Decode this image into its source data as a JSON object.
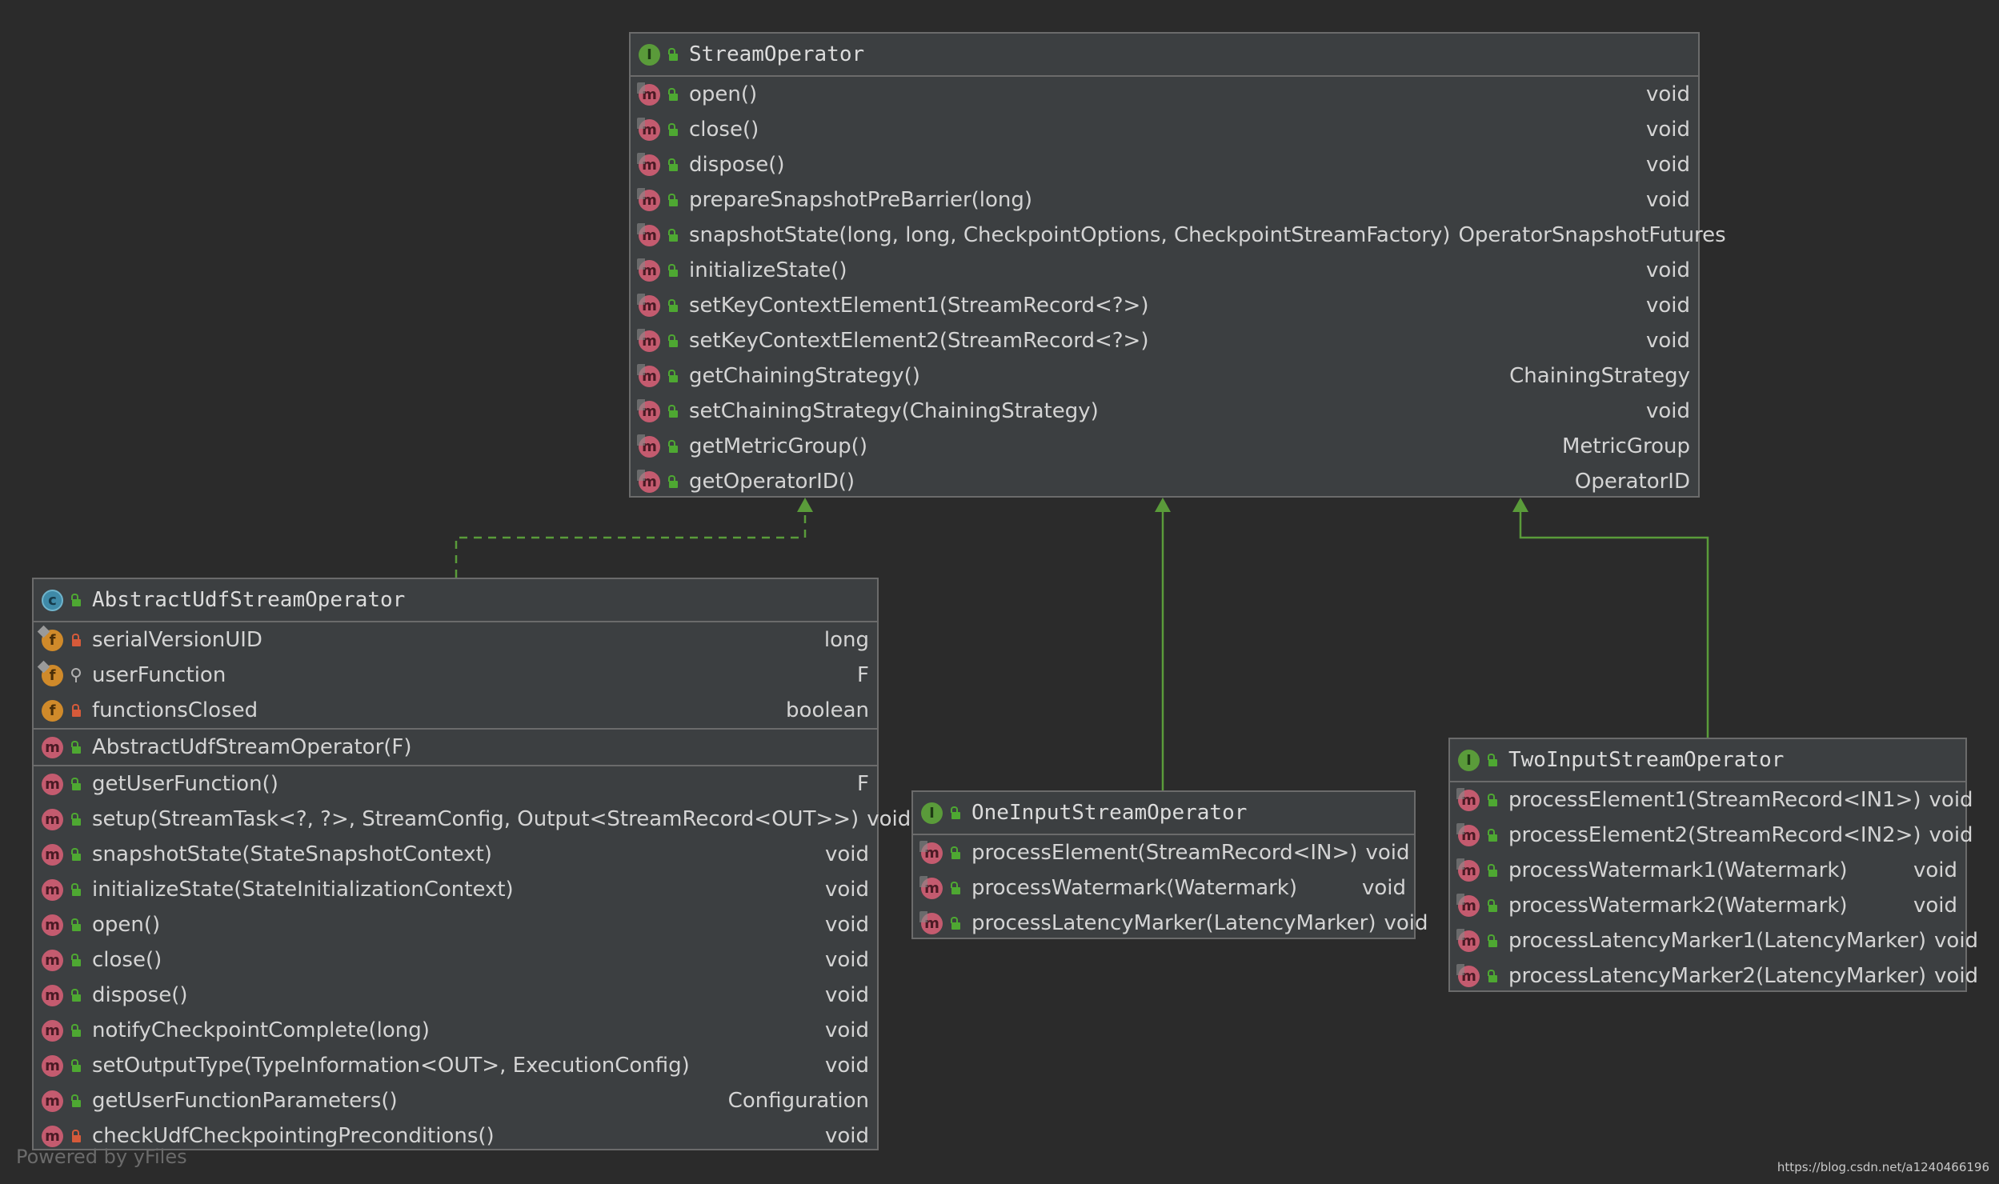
{
  "diagram": {
    "stream_operator": {
      "title": "StreamOperator",
      "kind_icon": "interface-icon",
      "methods": [
        {
          "name": "open()",
          "type": "void"
        },
        {
          "name": "close()",
          "type": "void"
        },
        {
          "name": "dispose()",
          "type": "void"
        },
        {
          "name": "prepareSnapshotPreBarrier(long)",
          "type": "void"
        },
        {
          "name": "snapshotState(long, long, CheckpointOptions, CheckpointStreamFactory)",
          "type": "OperatorSnapshotFutures"
        },
        {
          "name": "initializeState()",
          "type": "void"
        },
        {
          "name": "setKeyContextElement1(StreamRecord<?>)",
          "type": "void"
        },
        {
          "name": "setKeyContextElement2(StreamRecord<?>)",
          "type": "void"
        },
        {
          "name": "getChainingStrategy()",
          "type": "ChainingStrategy"
        },
        {
          "name": "setChainingStrategy(ChainingStrategy)",
          "type": "void"
        },
        {
          "name": "getMetricGroup()",
          "type": "MetricGroup"
        },
        {
          "name": "getOperatorID()",
          "type": "OperatorID"
        }
      ]
    },
    "abstract_udf_stream_operator": {
      "title": "AbstractUdfStreamOperator",
      "kind_icon": "class-icon",
      "fields": [
        {
          "name": "serialVersionUID",
          "type": "long",
          "visibility": "private",
          "static": true
        },
        {
          "name": "userFunction",
          "type": "F",
          "visibility": "protected",
          "static": true
        },
        {
          "name": "functionsClosed",
          "type": "boolean",
          "visibility": "private",
          "static": false
        }
      ],
      "constructors": [
        {
          "name": "AbstractUdfStreamOperator(F)",
          "type": "",
          "visibility": "public"
        }
      ],
      "methods": [
        {
          "name": "getUserFunction()",
          "type": "F",
          "visibility": "public"
        },
        {
          "name": "setup(StreamTask<?, ?>, StreamConfig, Output<StreamRecord<OUT>>)",
          "type": "void",
          "visibility": "public"
        },
        {
          "name": "snapshotState(StateSnapshotContext)",
          "type": "void",
          "visibility": "public"
        },
        {
          "name": "initializeState(StateInitializationContext)",
          "type": "void",
          "visibility": "public"
        },
        {
          "name": "open()",
          "type": "void",
          "visibility": "public"
        },
        {
          "name": "close()",
          "type": "void",
          "visibility": "public"
        },
        {
          "name": "dispose()",
          "type": "void",
          "visibility": "public"
        },
        {
          "name": "notifyCheckpointComplete(long)",
          "type": "void",
          "visibility": "public"
        },
        {
          "name": "setOutputType(TypeInformation<OUT>, ExecutionConfig)",
          "type": "void",
          "visibility": "public"
        },
        {
          "name": "getUserFunctionParameters()",
          "type": "Configuration",
          "visibility": "public"
        },
        {
          "name": "checkUdfCheckpointingPreconditions()",
          "type": "void",
          "visibility": "private"
        }
      ]
    },
    "one_input_stream_operator": {
      "title": "OneInputStreamOperator",
      "kind_icon": "interface-icon",
      "methods": [
        {
          "name": "processElement(StreamRecord<IN>)",
          "type": "void"
        },
        {
          "name": "processWatermark(Watermark)",
          "type": "void"
        },
        {
          "name": "processLatencyMarker(LatencyMarker)",
          "type": "void"
        }
      ]
    },
    "two_input_stream_operator": {
      "title": "TwoInputStreamOperator",
      "kind_icon": "interface-icon",
      "methods": [
        {
          "name": "processElement1(StreamRecord<IN1>)",
          "type": "void"
        },
        {
          "name": "processElement2(StreamRecord<IN2>)",
          "type": "void"
        },
        {
          "name": "processWatermark1(Watermark)",
          "type": "void"
        },
        {
          "name": "processWatermark2(Watermark)",
          "type": "void"
        },
        {
          "name": "processLatencyMarker1(LatencyMarker)",
          "type": "void"
        },
        {
          "name": "processLatencyMarker2(LatencyMarker)",
          "type": "void"
        }
      ]
    },
    "colors": {
      "background": "#2b2b2b",
      "box_fill": "#3c3f41",
      "box_border": "#6b6b6b",
      "arrow": "#5a9b3a",
      "method_icon": "#c45b6f",
      "field_icon": "#d08a2a",
      "interface_icon": "#5a9b3a",
      "class_icon": "#3f8aa8"
    }
  },
  "footer": {
    "powered_by": "Powered by yFiles",
    "watermark_url": "https://blog.csdn.net/a1240466196"
  }
}
